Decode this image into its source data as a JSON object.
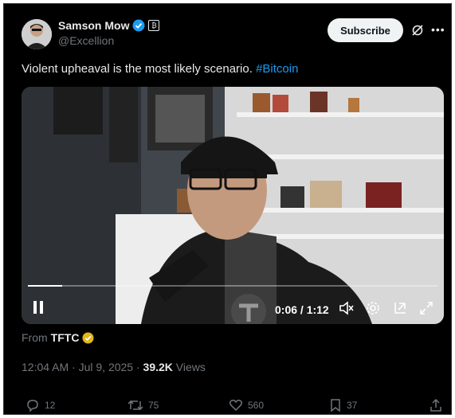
{
  "author": {
    "name": "Samson Mow",
    "handle": "@Excellion",
    "badge_tag": "₿"
  },
  "header": {
    "subscribe_label": "Subscribe"
  },
  "tweet": {
    "text": "Violent upheaval is the most likely scenario.",
    "hashtag": "#Bitcoin"
  },
  "video": {
    "time": "0:06 / 1:12",
    "progress": 0.083
  },
  "source": {
    "prefix": "From",
    "name": "TFTC"
  },
  "meta": {
    "timestamp": "12:04 AM · Jul 9, 2025 · ",
    "views_count": "39.2K",
    "views_label": "Views"
  },
  "actions": {
    "replies": "12",
    "reposts": "75",
    "likes": "560",
    "bookmarks": "37"
  },
  "colors": {
    "accent": "#1d9bf0",
    "verified": "#1d9bf0",
    "gold_badge": "#e2b719"
  }
}
